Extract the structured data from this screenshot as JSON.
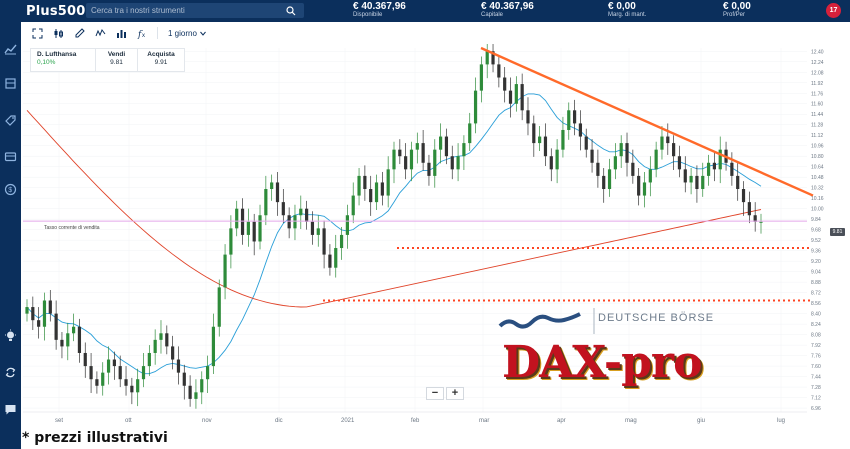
{
  "app": {
    "logo": "Plus500"
  },
  "search": {
    "placeholder": "Cerca tra i nostri strumenti"
  },
  "account": {
    "disponibile": {
      "value": "€ 40.367,96",
      "label": "Disponibile"
    },
    "capitale": {
      "value": "€ 40.367,96",
      "label": "Capitale"
    },
    "margine": {
      "value": "€ 0,00",
      "label": "Marg. di mant."
    },
    "profitto": {
      "value": "€ 0,00",
      "label": "Prof/Per"
    },
    "notifications": "17"
  },
  "toolbar": {
    "timeframe": "1 giorno"
  },
  "instrument": {
    "name": "D. Lufthansa",
    "change": "0,10%",
    "sell_label": "Vendi",
    "sell": "9.81",
    "buy_label": "Acquista",
    "buy": "9.91"
  },
  "annotations": {
    "tasso": "Tasso corrente di vendita",
    "last_price": "9.81",
    "deutsche_borse": "DEUTSCHE BÖRSE",
    "dax_pro": "DAX-pro",
    "footer": "* prezzi illustrativi"
  },
  "zoom": {
    "minus": "−",
    "plus": "+"
  },
  "colors": {
    "navy": "#0b2f5c",
    "up": "#2e8b3a",
    "down": "#333333",
    "ma_long": "#e0442a",
    "ma_short": "#2a9fd8",
    "trendline": "#ff6a2a"
  },
  "icons": [
    "chart-icon",
    "portfolio-icon",
    "orders-icon",
    "wallet-icon",
    "funds-icon",
    "lightbulb-icon",
    "switch-icon",
    "chat-icon"
  ],
  "chart_data": {
    "type": "candlestick",
    "x_labels": [
      "set",
      "ott",
      "nov",
      "dic",
      "2021",
      "feb",
      "mar",
      "apr",
      "mag",
      "giu",
      "lug"
    ],
    "y_ticks": [
      "12.40",
      "12.24",
      "12.08",
      "11.92",
      "11.76",
      "11.60",
      "11.44",
      "11.28",
      "11.12",
      "10.96",
      "10.80",
      "10.64",
      "10.48",
      "10.32",
      "10.16",
      "10.00",
      "9.84",
      "9.68",
      "9.52",
      "9.36",
      "9.20",
      "9.04",
      "8.88",
      "8.72",
      "8.56",
      "8.40",
      "8.24",
      "8.08",
      "7.92",
      "7.76",
      "7.60",
      "7.44",
      "7.28",
      "7.12",
      "6.96"
    ],
    "ylim": [
      6.9,
      12.45
    ],
    "closes": [
      8.5,
      8.3,
      8.2,
      8.6,
      8.4,
      8.0,
      7.9,
      8.1,
      8.2,
      7.8,
      7.6,
      7.4,
      7.3,
      7.5,
      7.7,
      7.6,
      7.4,
      7.3,
      7.2,
      7.4,
      7.6,
      7.8,
      8.0,
      8.1,
      7.9,
      7.7,
      7.5,
      7.3,
      7.1,
      7.2,
      7.4,
      7.6,
      8.2,
      8.8,
      9.3,
      9.7,
      10.0,
      9.6,
      9.8,
      9.5,
      9.9,
      10.3,
      10.4,
      10.1,
      9.9,
      9.7,
      9.9,
      10.0,
      9.8,
      9.6,
      9.7,
      9.3,
      9.1,
      9.4,
      9.6,
      9.9,
      10.2,
      10.5,
      10.3,
      10.1,
      10.4,
      10.2,
      10.6,
      10.9,
      10.8,
      10.6,
      10.9,
      11.0,
      10.7,
      10.5,
      10.9,
      11.1,
      10.8,
      10.6,
      10.8,
      11.0,
      11.3,
      11.8,
      12.2,
      12.4,
      12.2,
      12.0,
      11.8,
      11.6,
      11.9,
      11.5,
      11.3,
      11.0,
      11.1,
      10.8,
      10.6,
      10.9,
      11.2,
      11.5,
      11.3,
      11.1,
      10.9,
      10.7,
      10.5,
      10.3,
      10.6,
      10.8,
      11.0,
      10.7,
      10.5,
      10.2,
      10.4,
      10.6,
      10.9,
      11.1,
      11.0,
      10.8,
      10.6,
      10.4,
      10.5,
      10.3,
      10.5,
      10.7,
      10.6,
      10.9,
      10.7,
      10.5,
      10.3,
      10.1,
      9.9,
      9.8,
      9.8
    ],
    "trendline": {
      "from": {
        "month": "mar",
        "value": 12.45
      },
      "to": {
        "month": "lug",
        "value": 10.2
      }
    },
    "supports": [
      9.4,
      8.6
    ],
    "last": 9.81
  }
}
